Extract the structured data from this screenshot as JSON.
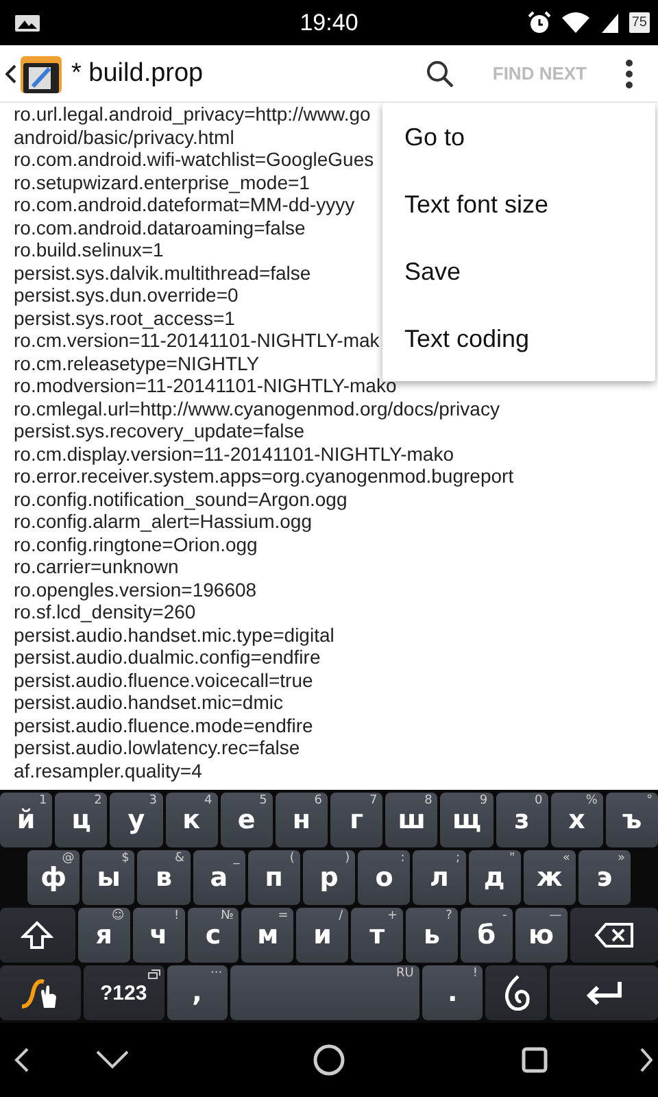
{
  "status_bar": {
    "time": "19:40",
    "battery": "75"
  },
  "toolbar": {
    "title": "* build.prop",
    "action": "FIND NEXT"
  },
  "editor": {
    "lines": [
      "ro.url.legal.android_privacy=http://www.go",
      "android/basic/privacy.html",
      "ro.com.android.wifi-watchlist=GoogleGues",
      "ro.setupwizard.enterprise_mode=1",
      "ro.com.android.dateformat=MM-dd-yyyy",
      "ro.com.android.dataroaming=false",
      "ro.build.selinux=1",
      "persist.sys.dalvik.multithread=false",
      "persist.sys.dun.override=0",
      "persist.sys.root_access=1",
      "ro.cm.version=11-20141101-NIGHTLY-mak",
      "ro.cm.releasetype=NIGHTLY",
      "ro.modversion=11-20141101-NIGHTLY-mako",
      "ro.cmlegal.url=http://www.cyanogenmod.org/docs/privacy",
      "persist.sys.recovery_update=false",
      "ro.cm.display.version=11-20141101-NIGHTLY-mako",
      "ro.error.receiver.system.apps=org.cyanogenmod.bugreport",
      "ro.config.notification_sound=Argon.ogg",
      "ro.config.alarm_alert=Hassium.ogg",
      "ro.config.ringtone=Orion.ogg",
      "ro.carrier=unknown",
      "ro.opengles.version=196608",
      "ro.sf.lcd_density=260",
      "persist.audio.handset.mic.type=digital",
      "persist.audio.dualmic.config=endfire",
      "persist.audio.fluence.voicecall=true",
      "persist.audio.handset.mic=dmic",
      "persist.audio.fluence.mode=endfire",
      "persist.audio.lowlatency.rec=false",
      "af.resampler.quality=4"
    ]
  },
  "menu": {
    "items": [
      {
        "label": "Go to"
      },
      {
        "label": "Text font size"
      },
      {
        "label": "Save"
      },
      {
        "label": "Text coding"
      }
    ]
  },
  "keyboard": {
    "rows": [
      [
        {
          "kind": "letter",
          "label": "й",
          "hint": "1"
        },
        {
          "kind": "letter",
          "label": "ц",
          "hint": "2"
        },
        {
          "kind": "letter",
          "label": "у",
          "hint": "3"
        },
        {
          "kind": "letter",
          "label": "к",
          "hint": "4"
        },
        {
          "kind": "letter",
          "label": "е",
          "hint": "5"
        },
        {
          "kind": "letter",
          "label": "н",
          "hint": "6"
        },
        {
          "kind": "letter",
          "label": "г",
          "hint": "7"
        },
        {
          "kind": "letter",
          "label": "ш",
          "hint": "8"
        },
        {
          "kind": "letter",
          "label": "щ",
          "hint": "9"
        },
        {
          "kind": "letter",
          "label": "з",
          "hint": "0"
        },
        {
          "kind": "letter",
          "label": "х",
          "hint": "%"
        },
        {
          "kind": "letter",
          "label": "ъ",
          "hint": "°"
        }
      ],
      [
        {
          "kind": "letter",
          "label": "ф",
          "hint": "@"
        },
        {
          "kind": "letter",
          "label": "ы",
          "hint": "$"
        },
        {
          "kind": "letter",
          "label": "в",
          "hint": "&"
        },
        {
          "kind": "letter",
          "label": "а",
          "hint": "_"
        },
        {
          "kind": "letter",
          "label": "п",
          "hint": "("
        },
        {
          "kind": "letter",
          "label": "р",
          "hint": ")"
        },
        {
          "kind": "letter",
          "label": "о",
          "hint": ":"
        },
        {
          "kind": "letter",
          "label": "л",
          "hint": ";"
        },
        {
          "kind": "letter",
          "label": "д",
          "hint": "\""
        },
        {
          "kind": "letter",
          "label": "ж",
          "hint": "«"
        },
        {
          "kind": "letter",
          "label": "э",
          "hint": "»"
        }
      ],
      [
        {
          "kind": "shift"
        },
        {
          "kind": "letter",
          "label": "я",
          "hint": "☺"
        },
        {
          "kind": "letter",
          "label": "ч",
          "hint": "!"
        },
        {
          "kind": "letter",
          "label": "с",
          "hint": "№"
        },
        {
          "kind": "letter",
          "label": "м",
          "hint": "="
        },
        {
          "kind": "letter",
          "label": "и",
          "hint": "/"
        },
        {
          "kind": "letter",
          "label": "т",
          "hint": "+"
        },
        {
          "kind": "letter",
          "label": "ь",
          "hint": "?"
        },
        {
          "kind": "letter",
          "label": "б",
          "hint": "-"
        },
        {
          "kind": "letter",
          "label": "ю",
          "hint": "—"
        },
        {
          "kind": "backspace"
        }
      ],
      [
        {
          "kind": "swype"
        },
        {
          "kind": "symbols",
          "label": "?123"
        },
        {
          "kind": "comma",
          "label": ",",
          "hint": "···"
        },
        {
          "kind": "space",
          "hint": "RU"
        },
        {
          "kind": "period",
          "label": ".",
          "hint": "!"
        },
        {
          "kind": "voice"
        },
        {
          "kind": "enter"
        }
      ]
    ]
  }
}
